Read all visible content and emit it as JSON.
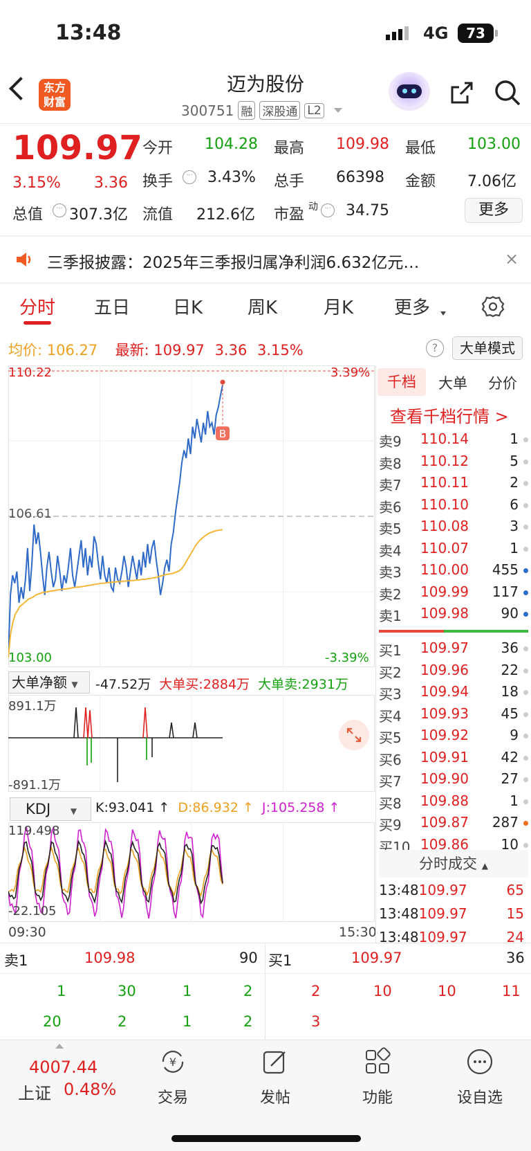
{
  "status_bar": {
    "time": "13:48",
    "network": "4G",
    "battery": "73"
  },
  "header": {
    "logo_text": "东方财富",
    "stock_name": "迈为股份",
    "stock_code": "300751",
    "tags": [
      "融",
      "深股通",
      "L2"
    ]
  },
  "quote": {
    "price": "109.97",
    "change_pct": "3.15%",
    "change": "3.36",
    "fields": [
      {
        "label": "今开",
        "value": "104.28",
        "color": "#13a10e"
      },
      {
        "label": "最高",
        "value": "109.98",
        "color": "#e02020"
      },
      {
        "label": "最低",
        "value": "103.00",
        "color": "#13a10e"
      },
      {
        "label": "换手",
        "value": "3.43%",
        "color": "#222222"
      },
      {
        "label": "总手",
        "value": "66398",
        "color": "#222222"
      },
      {
        "label": "金额",
        "value": "7.06亿",
        "color": "#222222"
      },
      {
        "label": "总值",
        "value": "307.3亿",
        "color": "#222222"
      },
      {
        "label": "流值",
        "value": "212.6亿",
        "color": "#222222"
      },
      {
        "label": "市盈",
        "label_sup": "动",
        "value": "34.75",
        "color": "#222222"
      }
    ],
    "more_label": "更多"
  },
  "announcement": {
    "text": "三季报披露：2025年三季报归属净利润6.632亿元…",
    "close": "×"
  },
  "tabs": [
    "分时",
    "五日",
    "日K",
    "周K",
    "月K",
    "更多"
  ],
  "info_line": {
    "avg_label": "均价:",
    "avg_value": "106.27",
    "latest_label": "最新:",
    "latest_value": "109.97",
    "change": "3.36",
    "change_pct": "3.15%",
    "mode_button": "大单模式"
  },
  "chart_data": {
    "type": "line",
    "y_top_label": "110.22",
    "y_mid_label": "106.61",
    "y_bottom_label": "103.00",
    "pct_top_label": "3.39%",
    "pct_bottom_label": "-3.39%",
    "ylim": [
      103.0,
      110.22
    ],
    "x_start_label": "09:30",
    "x_end_label": "15:30",
    "buy_marker": "B",
    "series": [
      {
        "name": "价格",
        "color": "#2f6ac8",
        "values": [
          103.0,
          104.6,
          105.1,
          104.9,
          105.2,
          104.4,
          104.8,
          104.5,
          105.0,
          105.8,
          104.7,
          105.4,
          106.4,
          105.9,
          106.2,
          105.7,
          105.1,
          104.6,
          105.3,
          105.7,
          105.2,
          104.8,
          105.0,
          105.6,
          105.2,
          104.7,
          105.1,
          104.9,
          105.3,
          105.8,
          105.1,
          104.8,
          105.2,
          105.6,
          106.0,
          105.3,
          105.8,
          105.1,
          105.6,
          105.3,
          106.1,
          105.9,
          105.4,
          105.0,
          105.6,
          105.1,
          104.9,
          105.3,
          104.8,
          104.7,
          105.3,
          105.0,
          104.9,
          105.2,
          105.6,
          105.3,
          104.8,
          105.2,
          105.6,
          105.3,
          105.0,
          105.5,
          105.1,
          105.7,
          105.3,
          105.9,
          105.4,
          105.8,
          106.0,
          105.5,
          105.1,
          104.6,
          104.9,
          105.3,
          105.5,
          105.2,
          105.9,
          106.2,
          106.7,
          107.1,
          107.5,
          108.0,
          108.3,
          108.1,
          108.6,
          108.2,
          108.9,
          108.6,
          109.1,
          108.8,
          108.5,
          109.0,
          108.7,
          109.3,
          108.9,
          109.0,
          108.7,
          109.2,
          109.4,
          109.7,
          109.97
        ]
      },
      {
        "name": "均价",
        "color": "#f5b638",
        "values": [
          103.0,
          103.6,
          103.9,
          104.1,
          104.2,
          104.3,
          104.35,
          104.4,
          104.45,
          104.5,
          104.52,
          104.55,
          104.6,
          104.62,
          104.64,
          104.66,
          104.67,
          104.68,
          104.69,
          104.7,
          104.71,
          104.72,
          104.73,
          104.74,
          104.75,
          104.75,
          104.76,
          104.77,
          104.78,
          104.79,
          104.8,
          104.8,
          104.81,
          104.82,
          104.83,
          104.84,
          104.85,
          104.86,
          104.87,
          104.88,
          104.89,
          104.9,
          104.9,
          104.91,
          104.92,
          104.92,
          104.93,
          104.93,
          104.94,
          104.94,
          104.95,
          104.95,
          104.96,
          104.96,
          104.97,
          104.97,
          104.98,
          104.98,
          104.99,
          105.0,
          105.0,
          105.01,
          105.02,
          105.03,
          105.04,
          105.05,
          105.07,
          105.09,
          105.1,
          105.12,
          105.13,
          105.14,
          105.15,
          105.17,
          105.19,
          105.22,
          105.27,
          105.35,
          105.45,
          105.55,
          105.65,
          105.75,
          105.85,
          105.93,
          106.0,
          106.05,
          106.1,
          106.14,
          106.18,
          106.2,
          106.22,
          106.24,
          106.25,
          106.26,
          106.27
        ]
      }
    ]
  },
  "net_flow": {
    "selector": "大单净额",
    "net_value": "-47.52万",
    "buy_label": "大单买:",
    "buy_value": "2884万",
    "sell_label": "大单卖:",
    "sell_value": "2931万",
    "top_label": "891.1万",
    "bottom_label": "-891.1万"
  },
  "kdj": {
    "selector": "KDJ",
    "k_label": "K:93.041 ↑",
    "d_label": "D:86.932 ↑",
    "j_label": "J:105.258 ↑",
    "top_label": "119.498",
    "bottom_label": "-22.105"
  },
  "orderbook": {
    "tabs": [
      "千档",
      "大单",
      "分价"
    ],
    "link": "查看千档行情 >",
    "asks": [
      {
        "label": "卖9",
        "price": "110.14",
        "vol": "1",
        "dot": "#cccccc"
      },
      {
        "label": "卖8",
        "price": "110.12",
        "vol": "5",
        "dot": "#cccccc"
      },
      {
        "label": "卖7",
        "price": "110.11",
        "vol": "2",
        "dot": "#cccccc"
      },
      {
        "label": "卖6",
        "price": "110.10",
        "vol": "6",
        "dot": "#cccccc"
      },
      {
        "label": "卖5",
        "price": "110.08",
        "vol": "3",
        "dot": "#cccccc"
      },
      {
        "label": "卖4",
        "price": "110.07",
        "vol": "1",
        "dot": "#cccccc"
      },
      {
        "label": "卖3",
        "price": "110.00",
        "vol": "455",
        "dot": "#2f6ac8"
      },
      {
        "label": "卖2",
        "price": "109.99",
        "vol": "117",
        "dot": "#2f6ac8"
      },
      {
        "label": "卖1",
        "price": "109.98",
        "vol": "90",
        "dot": "#2f6ac8"
      }
    ],
    "bids": [
      {
        "label": "买1",
        "price": "109.97",
        "vol": "36",
        "dot": "#cccccc"
      },
      {
        "label": "买2",
        "price": "109.96",
        "vol": "22",
        "dot": "#cccccc"
      },
      {
        "label": "买3",
        "price": "109.94",
        "vol": "18",
        "dot": "#cccccc"
      },
      {
        "label": "买4",
        "price": "109.93",
        "vol": "45",
        "dot": "#cccccc"
      },
      {
        "label": "买5",
        "price": "109.92",
        "vol": "9",
        "dot": "#cccccc"
      },
      {
        "label": "买6",
        "price": "109.91",
        "vol": "42",
        "dot": "#cccccc"
      },
      {
        "label": "买7",
        "price": "109.90",
        "vol": "27",
        "dot": "#cccccc"
      },
      {
        "label": "买8",
        "price": "109.88",
        "vol": "1",
        "dot": "#cccccc"
      },
      {
        "label": "买9",
        "price": "109.87",
        "vol": "287",
        "dot": "#f07020"
      },
      {
        "label": "买10",
        "price": "109.86",
        "vol": "10",
        "dot": "#cccccc"
      }
    ],
    "trades_header": "分时成交",
    "trades": [
      {
        "time": "13:48",
        "price": "109.97",
        "vol": "65"
      },
      {
        "time": "13:48",
        "price": "109.97",
        "vol": "15"
      },
      {
        "time": "13:48",
        "price": "109.97",
        "vol": "24"
      }
    ]
  },
  "strip": {
    "ask_label": "卖1",
    "ask_price": "109.98",
    "ask_vol": "90",
    "bid_label": "买1",
    "bid_price": "109.97",
    "bid_vol": "36",
    "ask_queue": [
      "1",
      "30",
      "1",
      "2",
      "20",
      "2",
      "1",
      "2"
    ],
    "bid_queue": [
      "2",
      "10",
      "10",
      "11",
      "3"
    ]
  },
  "bottom_nav": {
    "index_value": "4007.44",
    "index_name": "上证",
    "index_pct": "0.48%",
    "items": [
      "交易",
      "发帖",
      "功能",
      "设自选"
    ]
  },
  "colors": {
    "up": "#e02020",
    "down": "#13a10e",
    "brand": "#f05a22"
  }
}
